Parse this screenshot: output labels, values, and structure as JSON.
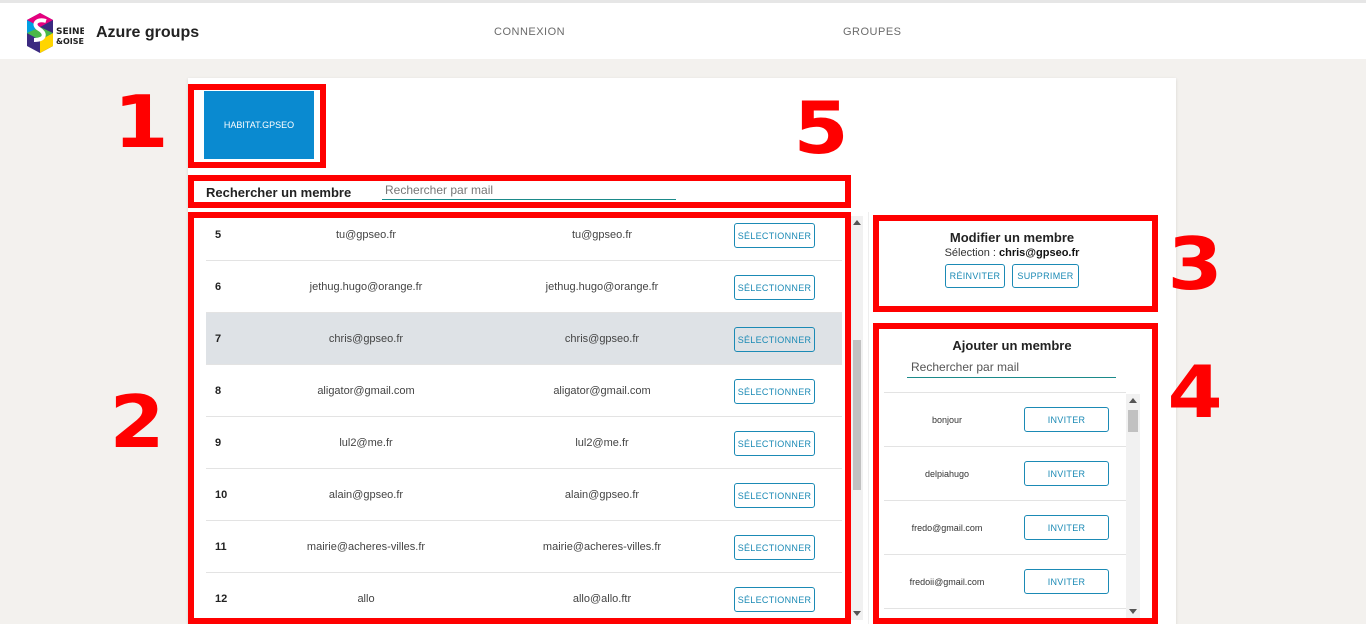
{
  "header": {
    "app_title": "Azure groups",
    "logo_text_line1": "SEINE",
    "logo_text_line2": "&OISE",
    "nav": [
      {
        "label": "CONNEXION"
      },
      {
        "label": "GROUPES"
      }
    ]
  },
  "annotations": [
    "1",
    "2",
    "3",
    "4",
    "5"
  ],
  "group": {
    "tile_label": "HABITAT.GPSEO"
  },
  "search": {
    "label": "Rechercher un membre",
    "placeholder": "Rechercher par mail"
  },
  "members": {
    "select_label": "SÉLECTIONNER",
    "rows": [
      {
        "id": "5",
        "name": "tu@gpseo.fr",
        "mail": "tu@gpseo.fr",
        "selected": false
      },
      {
        "id": "6",
        "name": "jethug.hugo@orange.fr",
        "mail": "jethug.hugo@orange.fr",
        "selected": false
      },
      {
        "id": "7",
        "name": "chris@gpseo.fr",
        "mail": "chris@gpseo.fr",
        "selected": true
      },
      {
        "id": "8",
        "name": "aligator@gmail.com",
        "mail": "aligator@gmail.com",
        "selected": false
      },
      {
        "id": "9",
        "name": "lul2@me.fr",
        "mail": "lul2@me.fr",
        "selected": false
      },
      {
        "id": "10",
        "name": "alain@gpseo.fr",
        "mail": "alain@gpseo.fr",
        "selected": false
      },
      {
        "id": "11",
        "name": "mairie@acheres-villes.fr",
        "mail": "mairie@acheres-villes.fr",
        "selected": false
      },
      {
        "id": "12",
        "name": "allo",
        "mail": "allo@allo.ftr",
        "selected": false
      }
    ]
  },
  "modify": {
    "title": "Modifier un membre",
    "selection_prefix": "Sélection : ",
    "selection_value": "chris@gpseo.fr",
    "reinvite_label": "RÉINVITER",
    "delete_label": "SUPPRIMER"
  },
  "add": {
    "title": "Ajouter un membre",
    "placeholder": "Rechercher par mail",
    "invite_label": "INVITER",
    "rows": [
      {
        "name": "bonjour"
      },
      {
        "name": "delpiahugo"
      },
      {
        "name": "fredo@gmail.com"
      },
      {
        "name": "fredoii@gmail.com"
      }
    ]
  },
  "colors": {
    "accent": "#1b8ab5",
    "tile": "#0a8ad0",
    "annotation": "#ff0000",
    "selected_row": "#dee2e6"
  }
}
